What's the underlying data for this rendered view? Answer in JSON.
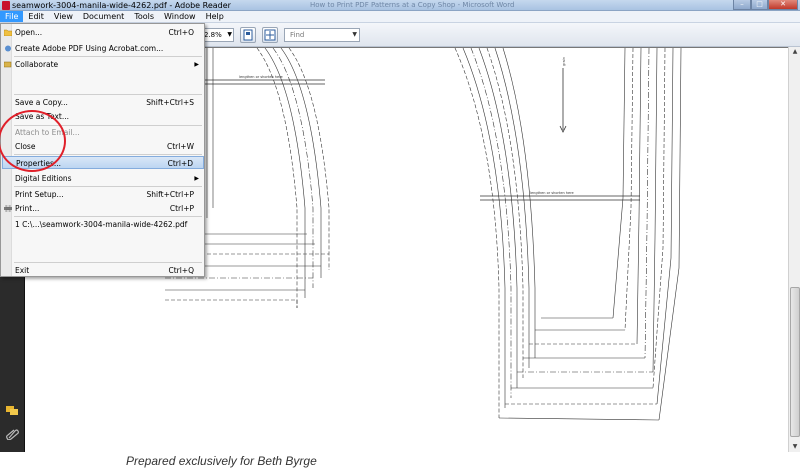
{
  "window": {
    "title": "seamwork-3004-manila-wide-4262.pdf - Adobe Reader",
    "ghost_title": "How to Print PDF Patterns at a Copy Shop - Microsoft Word"
  },
  "menubar": [
    "File",
    "Edit",
    "View",
    "Document",
    "Tools",
    "Window",
    "Help"
  ],
  "toolbar": {
    "zoom": "2.8%",
    "find_placeholder": "Find"
  },
  "file_menu": [
    {
      "label": "Open...",
      "shortcut": "Ctrl+O",
      "icon": "folder-icon"
    },
    {
      "label": "Create Adobe PDF Using Acrobat.com...",
      "shortcut": "",
      "icon": "acrobat-icon"
    },
    {
      "label": "Collaborate",
      "shortcut": "",
      "submenu": true,
      "icon": "collaborate-icon"
    },
    {
      "label": "Save a Copy...",
      "shortcut": "Shift+Ctrl+S"
    },
    {
      "label": "Save as Text...",
      "shortcut": ""
    },
    {
      "label": "Attach to Email...",
      "shortcut": "",
      "disabled": true
    },
    {
      "label": "Close",
      "shortcut": "Ctrl+W"
    },
    {
      "label": "Properties...",
      "shortcut": "Ctrl+D",
      "highlighted": true
    },
    {
      "label": "Digital Editions",
      "shortcut": "",
      "submenu": true
    },
    {
      "label": "Print Setup...",
      "shortcut": "Shift+Ctrl+P"
    },
    {
      "label": "Print...",
      "shortcut": "Ctrl+P",
      "icon": "printer-icon"
    },
    {
      "label": "1 C:\\...\\seamwork-3004-manila-wide-4262.pdf",
      "shortcut": ""
    },
    {
      "label": "Exit",
      "shortcut": "Ctrl+Q"
    }
  ],
  "document": {
    "caption": "Prepared exclusively for Beth Byrge",
    "line_label": "lengthen or shorten here",
    "grain_label": "grain"
  },
  "colors": {
    "highlight": "#3399ff",
    "annotation": "#e0202a"
  }
}
